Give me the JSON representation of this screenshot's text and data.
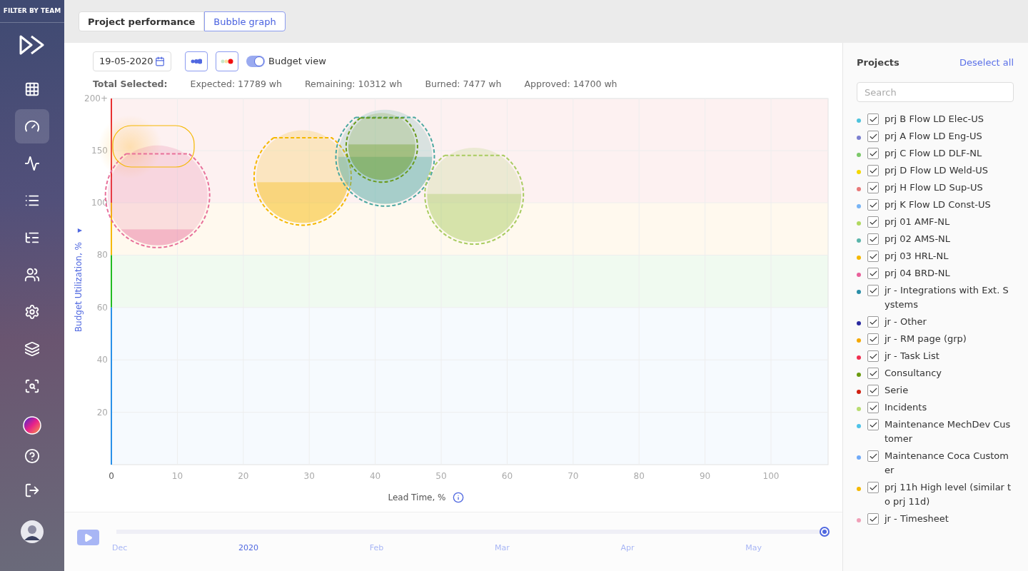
{
  "sidebar": {
    "title": "FILTER BY TEAM",
    "items": [
      {
        "kind": "grid",
        "selected": false
      },
      {
        "kind": "gauge",
        "selected": true
      },
      {
        "kind": "pulse",
        "selected": false
      },
      {
        "kind": "list",
        "selected": false
      },
      {
        "kind": "tree",
        "selected": false
      },
      {
        "kind": "users",
        "selected": false
      },
      {
        "kind": "settings",
        "selected": false
      },
      {
        "kind": "layers",
        "selected": false
      },
      {
        "kind": "search",
        "selected": false
      }
    ],
    "bottom": [
      {
        "kind": "orb"
      },
      {
        "kind": "help"
      },
      {
        "kind": "logout"
      },
      {
        "kind": "avatar"
      }
    ]
  },
  "tabs": [
    {
      "label": "Project performance",
      "selected": false
    },
    {
      "label": "Bubble graph",
      "selected": true
    }
  ],
  "toolbar": {
    "date": "19-05-2020",
    "budget_view": {
      "label": "Budget view",
      "on": true
    }
  },
  "totals": {
    "label": "Total Selected:",
    "items": [
      "Expected: 17789 wh",
      "Remaining: 10312 wh",
      "Burned: 7477 wh",
      "Approved: 14700 wh"
    ]
  },
  "chart": {
    "xlabel": "Lead Time, %",
    "ylabel": "Budget Utilization, %",
    "ylabel_caret": "▼",
    "x_ticks": [
      "0",
      "10",
      "20",
      "30",
      "40",
      "50",
      "60",
      "70",
      "80",
      "90",
      "100"
    ],
    "y_ticks": [
      "200+",
      "150",
      "100",
      "80",
      "60",
      "40",
      "20"
    ],
    "bubbles": [
      {
        "color": "#e8709a"
      },
      {
        "color": "#f5b800"
      },
      {
        "color": "#4aa8a0"
      },
      {
        "color": "#6a9a1a"
      },
      {
        "color": "#a8cc60"
      }
    ]
  },
  "timeline": {
    "months": [
      {
        "label": "Dec",
        "selected": false
      },
      {
        "label": "2020",
        "selected": true
      },
      {
        "label": "Feb",
        "selected": false
      },
      {
        "label": "Mar",
        "selected": false
      },
      {
        "label": "Apr",
        "selected": false
      },
      {
        "label": "May",
        "selected": false
      }
    ],
    "level": 1
  },
  "projects": {
    "title": "Projects",
    "action": "Deselect all",
    "search": {
      "placeholder": "Search"
    },
    "items": [
      {
        "name": "prj B Flow LD Elec-US",
        "color": "#4ec3dc",
        "checked": true
      },
      {
        "name": "prj A Flow LD Eng-US",
        "color": "#7b7fd0",
        "checked": true
      },
      {
        "name": "prj C Flow LD DLF-NL",
        "color": "#7cc86a",
        "checked": true
      },
      {
        "name": "prj D Flow LD Weld-US",
        "color": "#f5d800",
        "checked": true
      },
      {
        "name": "prj H Flow LD Sup-US",
        "color": "#e87878",
        "checked": true
      },
      {
        "name": "prj K Flow LD Const-US",
        "color": "#78b4f5",
        "checked": true
      },
      {
        "name": "prj 01 AMF-NL",
        "color": "#b0d860",
        "checked": true
      },
      {
        "name": "prj 02 AMS-NL",
        "color": "#5ab4aa",
        "checked": true
      },
      {
        "name": "prj 03 HRL-NL",
        "color": "#f5b800",
        "checked": true
      },
      {
        "name": "prj 04 BRD-NL",
        "color": "#e8609a",
        "checked": true
      },
      {
        "name": "jr - Integrations with Ext. Systems",
        "color": "#2a8ea8",
        "checked": true
      },
      {
        "name": "jr - Other",
        "color": "#2a2aa0",
        "checked": true
      },
      {
        "name": "jr - RM page (grp)",
        "color": "#f5a800",
        "checked": true
      },
      {
        "name": "jr - Task List",
        "color": "#f03050",
        "checked": true
      },
      {
        "name": "Consultancy",
        "color": "#6a9a10",
        "checked": true
      },
      {
        "name": "Serie",
        "color": "#d02010",
        "checked": true
      },
      {
        "name": "Incidents",
        "color": "#b8dc70",
        "checked": true
      },
      {
        "name": "Maintenance MechDev Customer",
        "color": "#4ec3e8",
        "checked": true
      },
      {
        "name": "Maintenance Coca Customer",
        "color": "#70aaf8",
        "checked": true
      },
      {
        "name": "prj 11h High level (similar to prj 11d)",
        "color": "#f5b800",
        "checked": true
      },
      {
        "name": "jr - Timesheet",
        "color": "#f0a0b8",
        "checked": true
      }
    ]
  }
}
